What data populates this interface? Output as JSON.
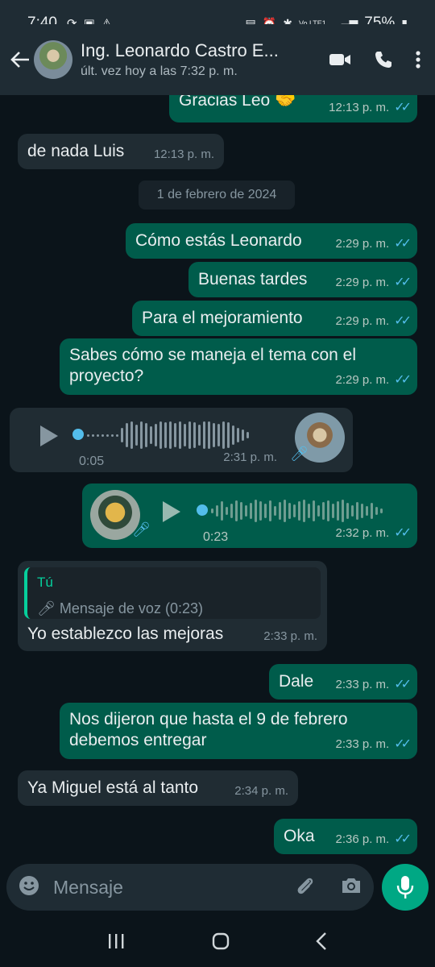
{
  "status_bar": {
    "time": "7:40",
    "battery": "75%",
    "network_label": "Vo LTE1"
  },
  "header": {
    "contact_name": "Ing. Leonardo Castro E...",
    "last_seen": "últ. vez hoy a las 7:32 p. m.",
    "icons": [
      "back-arrow-icon",
      "video-call-icon",
      "phone-icon",
      "more-vert-icon"
    ]
  },
  "messages": [
    {
      "dir": "out",
      "text": "Gracias Leo 🤝",
      "time": "12:13 p. m.",
      "read": true
    },
    {
      "dir": "in",
      "text": "de nada Luis",
      "time": "12:13 p. m."
    },
    {
      "type": "date",
      "text": "1 de febrero de 2024"
    },
    {
      "dir": "out",
      "text": "Cómo estás Leonardo",
      "time": "2:29 p. m.",
      "read": true
    },
    {
      "dir": "out",
      "text": "Buenas tardes",
      "time": "2:29 p. m.",
      "read": true
    },
    {
      "dir": "out",
      "text": "Para el mejoramiento",
      "time": "2:29 p. m.",
      "read": true
    },
    {
      "dir": "out",
      "text": "Sabes cómo se maneja el tema con el proyecto?",
      "time": "2:29 p. m.",
      "read": true
    },
    {
      "dir": "in",
      "type": "voice",
      "duration": "0:05",
      "time": "2:31 p. m.",
      "progress": 0.0
    },
    {
      "dir": "out",
      "type": "voice",
      "duration": "0:23",
      "time": "2:32 p. m.",
      "read": true,
      "progress": 0.0
    },
    {
      "dir": "in",
      "quote_author": "Tú",
      "quote_text": "Mensaje de voz (0:23)",
      "text": "Yo establezco las mejoras",
      "time": "2:33 p. m."
    },
    {
      "dir": "out",
      "text": "Dale",
      "time": "2:33 p. m.",
      "read": true
    },
    {
      "dir": "out",
      "text": "Nos dijeron que hasta el 9 de febrero debemos entregar",
      "time": "2:33 p. m.",
      "read": true
    },
    {
      "dir": "in",
      "text": "Ya Miguel está al tanto",
      "time": "2:34 p. m."
    },
    {
      "dir": "out",
      "text": "Oka",
      "time": "2:36 p. m.",
      "read": true
    }
  ],
  "input": {
    "placeholder": "Mensaje",
    "icons": [
      "emoji-icon",
      "attach-icon",
      "camera-icon",
      "mic-icon"
    ]
  },
  "colors": {
    "outgoing": "#005c4b",
    "incoming": "#202c33",
    "accent": "#00a884",
    "read_tick": "#53bdeb"
  }
}
